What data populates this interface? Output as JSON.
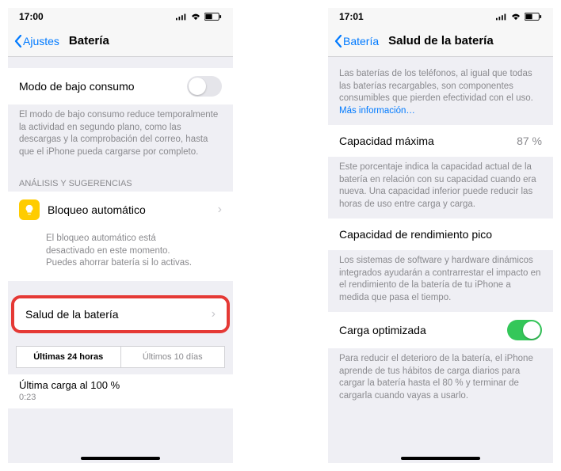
{
  "left": {
    "status": {
      "time": "17:00"
    },
    "nav": {
      "back": "Ajustes",
      "title": "Batería"
    },
    "lowPower": {
      "label": "Modo de bajo consumo",
      "on": false,
      "footer": "El modo de bajo consumo reduce temporalmente la actividad en segundo plano, como las descargas y la comprobación del correo, hasta que el iPhone pueda cargarse por completo."
    },
    "analysisHeader": "ANÁLISIS Y SUGERENCIAS",
    "suggestion": {
      "title": "Bloqueo automático",
      "detail": "El bloqueo automático está desactivado en este momento. Puedes ahorrar batería si lo activas."
    },
    "batteryHealth": {
      "label": "Salud de la batería"
    },
    "segments": {
      "a": "Últimas 24 horas",
      "b": "Últimos 10 días"
    },
    "lastCharge": {
      "label": "Última carga al 100 %",
      "time": "0:23"
    }
  },
  "right": {
    "status": {
      "time": "17:01"
    },
    "nav": {
      "back": "Batería",
      "title": "Salud de la batería"
    },
    "intro": "Las baterías de los teléfonos, al igual que todas las baterías recargables, son componentes consumibles que pierden efectividad con el uso.",
    "introLink": "Más información…",
    "maxCap": {
      "label": "Capacidad máxima",
      "value": "87 %",
      "footer": "Este porcentaje indica la capacidad actual de la batería en relación con su capacidad cuando era nueva. Una capacidad inferior puede reducir las horas de uso entre carga y carga."
    },
    "peak": {
      "label": "Capacidad de rendimiento pico",
      "footer": "Los sistemas de software y hardware dinámicos integrados ayudarán a contrarrestar el impacto en el rendimiento de la batería de tu iPhone a medida que pasa el tiempo."
    },
    "optimized": {
      "label": "Carga optimizada",
      "on": true,
      "footer": "Para reducir el deterioro de la batería, el iPhone aprende de tus hábitos de carga diarios para cargar la batería hasta el 80 % y terminar de cargarla cuando vayas a usarlo."
    }
  }
}
